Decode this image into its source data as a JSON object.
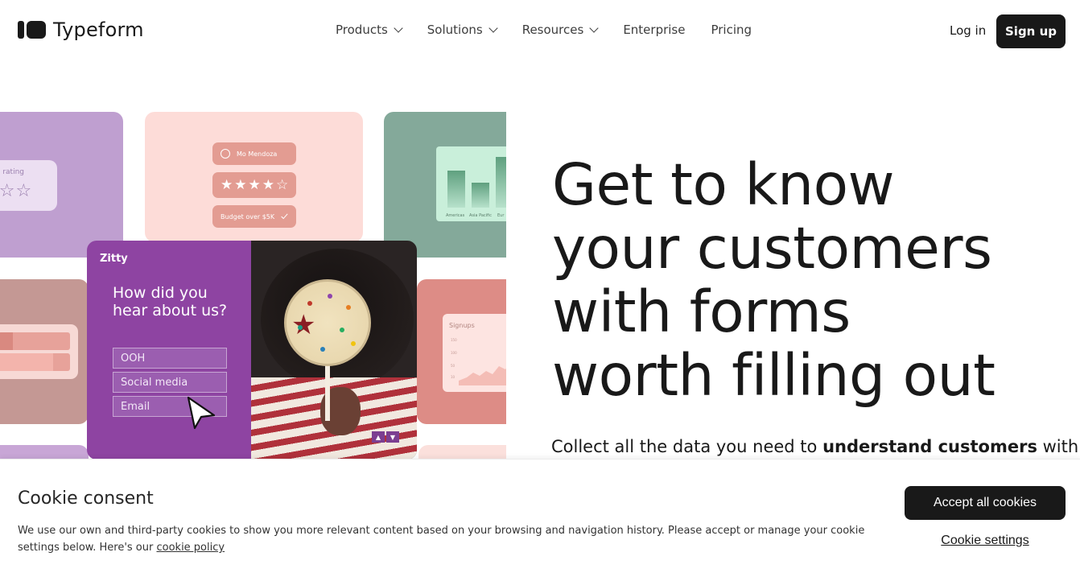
{
  "header": {
    "logo_text": "Typeform",
    "nav": [
      {
        "label": "Products",
        "has_dropdown": true
      },
      {
        "label": "Solutions",
        "has_dropdown": true
      },
      {
        "label": "Resources",
        "has_dropdown": true
      },
      {
        "label": "Enterprise",
        "has_dropdown": false
      },
      {
        "label": "Pricing",
        "has_dropdown": false
      }
    ],
    "login_label": "Log in",
    "signup_label": "Sign up"
  },
  "collage": {
    "rating_label": "rage rating",
    "rating_stars": "★☆☆",
    "profile_name": "Mo Mendoza",
    "stars_pill": "★★★★☆",
    "budget_pill": "Budget over $5K",
    "chart_labels": [
      "Americas",
      "Asia Pacific",
      "Eur"
    ],
    "signups_title": "Signups",
    "signups_ticks": [
      "150",
      "100",
      "50",
      "10"
    ],
    "form": {
      "brand": "Zitty",
      "question": "How did you hear about us?",
      "options": [
        "OOH",
        "Social media",
        "Email"
      ]
    }
  },
  "hero": {
    "headline_lines": [
      "Get to know",
      "your customers",
      "with forms",
      "worth filling out"
    ],
    "subline_start": "Collect all the data you need to ",
    "subline_bold": "understand customers",
    "subline_end": " with"
  },
  "cookie_banner": {
    "title": "Cookie consent",
    "text": "We use our own and third-party cookies to show you more relevant content based on your browsing and navigation history. Please accept or manage your cookie settings below. Here's our ",
    "policy_link": "cookie policy",
    "accept_label": "Accept all cookies",
    "settings_label": "Cookie settings"
  },
  "colors": {
    "brand_dark": "#191919",
    "form_purple": "#8e44a2",
    "card_pink": "#fddcd8",
    "card_green": "#84a99a",
    "card_lilac": "#bf9fd0"
  }
}
